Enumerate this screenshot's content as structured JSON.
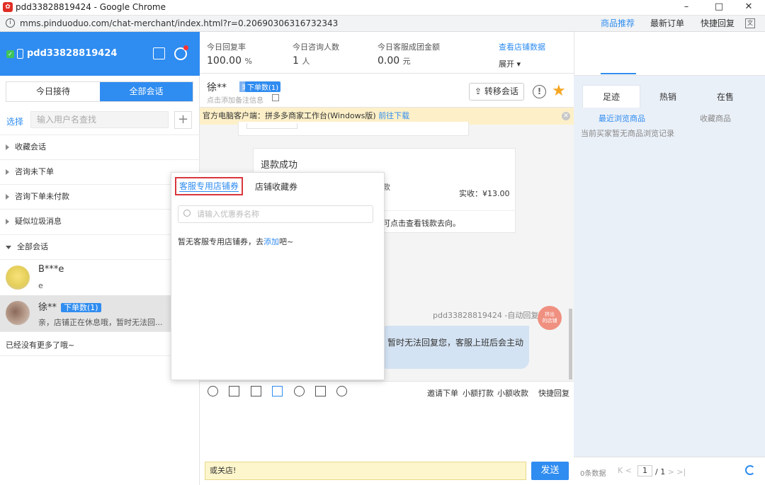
{
  "window": {
    "title": "pdd33828819424 - Google Chrome",
    "minimize": "–",
    "maximize": "□",
    "close": "✕"
  },
  "address": {
    "url": "mms.pinduoduo.com/chat-merchant/index.html?r=0.20690306316732343",
    "info_glyph": "i"
  },
  "sidebar": {
    "account": "pdd33828819424",
    "tabs": {
      "today": "今日接待",
      "all": "全部会话"
    },
    "select_label": "选择",
    "search_placeholder": "输入用户名查找",
    "plus": "+",
    "groups": [
      {
        "label": "收藏会话",
        "expanded": false
      },
      {
        "label": "咨询未下单",
        "expanded": false
      },
      {
        "label": "咨询下单未付款",
        "expanded": false
      },
      {
        "label": "疑似垃圾消息",
        "expanded": false
      },
      {
        "label": "全部会话",
        "expanded": true
      }
    ],
    "conversations": [
      {
        "name": "B***e",
        "last": "e",
        "badge": ""
      },
      {
        "name": "徐**",
        "last": "亲，店铺正在休息哦，暂时无法回...",
        "badge": "下单数(1)"
      }
    ],
    "no_more": "已经没有更多了哦~"
  },
  "stats": {
    "reply_rate_label": "今日回复率",
    "reply_rate_value": "100.00",
    "reply_rate_unit": "%",
    "consult_label": "今日咨询人数",
    "consult_value": "1",
    "consult_unit": "人",
    "gmv_label": "今日客服成团金额",
    "gmv_value": "0.00",
    "gmv_unit": "元",
    "view_link": "查看店铺数据",
    "expand": "展开 ▾"
  },
  "chat": {
    "customer": "徐**",
    "gender": "男",
    "orders_badge": "下单数(1)",
    "note_placeholder": "点击添加备注信息",
    "transfer": "转移会话",
    "notice_text": "官方电脑客户端：拼多多商家工作台(Windows版) ",
    "notice_link": "前往下载",
    "refund_title": "退款成功",
    "refund_partial": "款",
    "refund_paid": "实收：¥13.00",
    "refund_hint": "可点击查看钱款去向。",
    "auto_reply_head": "pdd33828819424 -自动回复",
    "shop_avatar": "拼出\n的店铺",
    "bubble_line1": "暂时无法回复您，客服上班后会主动",
    "bubble_line2": "",
    "actions": [
      "邀请下单",
      "小额打款",
      "小额收款",
      "快捷回复"
    ],
    "input_text": "或关店!",
    "send": "发送"
  },
  "popup": {
    "tab_active": "客服专用店铺券",
    "tab_other": "店铺收藏券",
    "search_placeholder": "请输入优惠券名称",
    "empty_text": "暂无客服专用店铺券，去",
    "empty_link": "添加",
    "empty_suffix": "吧~"
  },
  "right": {
    "tabs": [
      "商品推荐",
      "最新订单",
      "快捷回复"
    ],
    "subtabs": [
      "足迹",
      "热销",
      "在售"
    ],
    "recent": "最近浏览商品",
    "collect": "收藏商品",
    "empty": "当前买家暂无商品浏览记录",
    "count": "0条数据",
    "nav": "K  <",
    "page": "1",
    "total": "/ 1",
    "nav_next": ">  >|"
  },
  "colors": {
    "accent": "#2f8cf0",
    "notice_bg": "#fdf0c8",
    "highlight_border": "#d9363e"
  }
}
